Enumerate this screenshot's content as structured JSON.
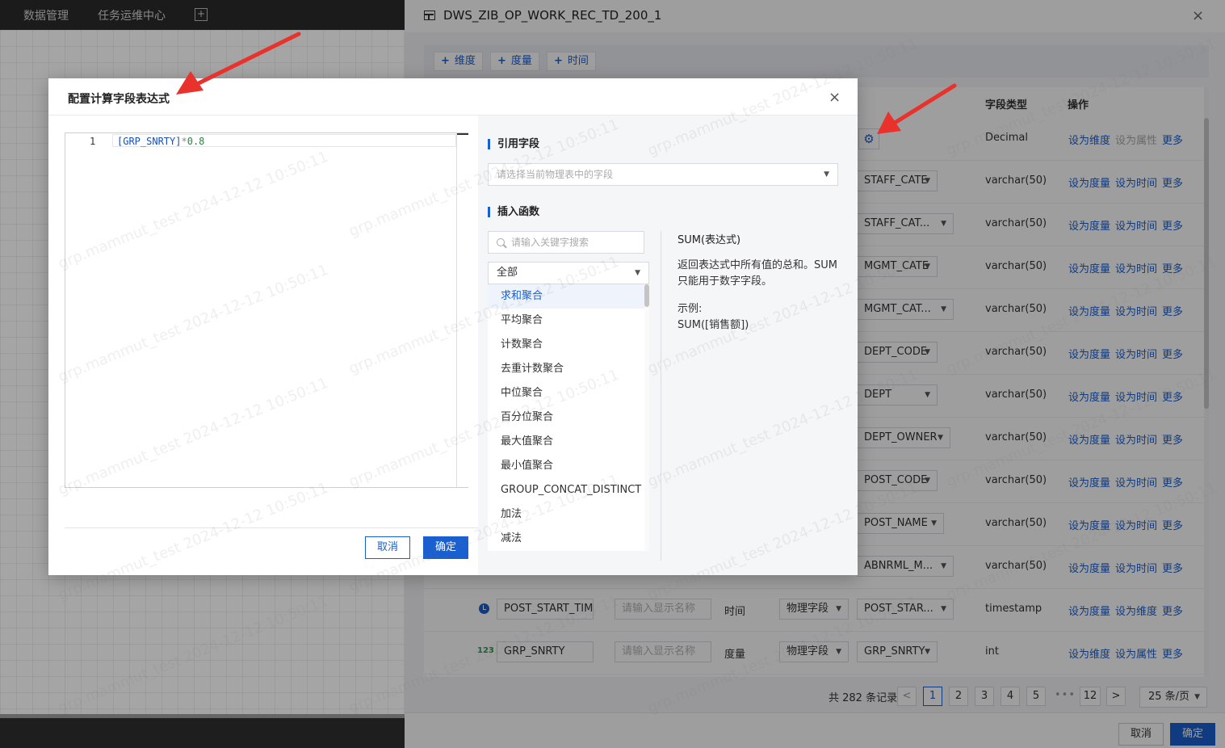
{
  "topnav": {
    "items": [
      "数据管理",
      "任务运维中心"
    ],
    "add_tab": "+"
  },
  "drawer": {
    "title": "DWS_ZIB_OP_WORK_REC_TD_200_1",
    "close": "×",
    "add_buttons": [
      "维度",
      "度量",
      "时间"
    ],
    "columns": {
      "field_type": "字段类型",
      "operation": "操作"
    },
    "rows": [
      {
        "field_select": "",
        "type": "Decimal",
        "actions": [
          "设为维度",
          "设为属性",
          "更多"
        ],
        "gear": true
      },
      {
        "field_select": "STAFF_CATE",
        "type": "varchar(50)",
        "actions": [
          "设为度量",
          "设为时间",
          "更多"
        ]
      },
      {
        "field_select": "STAFF_CAT...",
        "type": "varchar(50)",
        "actions": [
          "设为度量",
          "设为时间",
          "更多"
        ]
      },
      {
        "field_select": "MGMT_CATE",
        "type": "varchar(50)",
        "actions": [
          "设为度量",
          "设为时间",
          "更多"
        ]
      },
      {
        "field_select": "MGMT_CAT...",
        "type": "varchar(50)",
        "actions": [
          "设为度量",
          "设为时间",
          "更多"
        ]
      },
      {
        "field_select": "DEPT_CODE",
        "type": "varchar(50)",
        "actions": [
          "设为度量",
          "设为时间",
          "更多"
        ]
      },
      {
        "field_select": "DEPT",
        "type": "varchar(50)",
        "actions": [
          "设为度量",
          "设为时间",
          "更多"
        ]
      },
      {
        "field_select": "DEPT_OWNER",
        "type": "varchar(50)",
        "actions": [
          "设为度量",
          "设为时间",
          "更多"
        ]
      },
      {
        "field_select": "POST_CODE",
        "type": "varchar(50)",
        "actions": [
          "设为度量",
          "设为时间",
          "更多"
        ]
      },
      {
        "field_select": "POST_NAME",
        "type": "varchar(50)",
        "actions": [
          "设为度量",
          "设为时间",
          "更多"
        ]
      },
      {
        "field_select": "ABNRML_M...",
        "type": "varchar(50)",
        "actions": [
          "设为度量",
          "设为时间",
          "更多"
        ]
      },
      {
        "icon": "clock",
        "name": "POST_START_TIM",
        "display_placeholder": "请输入显示名称",
        "role": "时间",
        "source": "物理字段",
        "field_select": "POST_STAR...",
        "type": "timestamp",
        "actions": [
          "设为度量",
          "设为维度",
          "更多"
        ]
      },
      {
        "icon": "123",
        "name": "GRP_SNRTY",
        "display_placeholder": "请输入显示名称",
        "role": "度量",
        "source": "物理字段",
        "field_select": "GRP_SNRTY",
        "type": "int",
        "actions": [
          "设为维度",
          "设为属性",
          "更多"
        ]
      }
    ],
    "pagination": {
      "total": "共 282 条记录",
      "pages": [
        "1",
        "2",
        "3",
        "4",
        "5",
        "12"
      ],
      "ellipsis": "•••",
      "prev": "<",
      "next": ">",
      "page_size": "25 条/页"
    },
    "footer": {
      "cancel": "取消",
      "ok": "确定"
    }
  },
  "modal": {
    "title": "配置计算字段表达式",
    "close": "×",
    "editor": {
      "line_number": "1",
      "tokens": {
        "field": "[GRP_SNRTY]",
        "op": "*",
        "num": "0.8"
      }
    },
    "ref_section": {
      "title": "引用字段",
      "placeholder": "请选择当前物理表中的字段"
    },
    "fn_section": {
      "title": "插入函数",
      "search_placeholder": "请输入关键字搜索",
      "category": "全部",
      "functions": [
        "求和聚合",
        "平均聚合",
        "计数聚合",
        "去重计数聚合",
        "中位聚合",
        "百分位聚合",
        "最大值聚合",
        "最小值聚合",
        "GROUP_CONCAT_DISTINCT",
        "加法",
        "减法"
      ],
      "selected": 0
    },
    "doc": {
      "title": "SUM(表达式)",
      "description": "返回表达式中所有值的总和。SUM只能用于数字字段。",
      "example_label": "示例:",
      "example": "SUM([销售额])"
    },
    "buttons": {
      "cancel": "取消",
      "ok": "确定"
    }
  },
  "watermark": "grp.mammut_test 2024-12-12 10:50:11",
  "colors": {
    "accent": "#1a5fd0",
    "arrow": "#e8322b",
    "number_icon": "#2a9d4a"
  }
}
